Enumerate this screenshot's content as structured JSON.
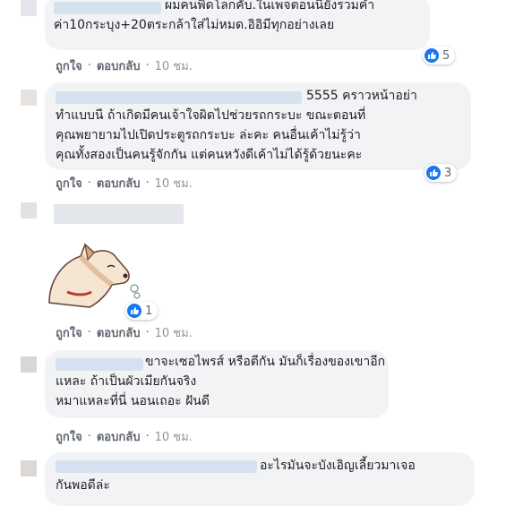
{
  "actions": {
    "like": "ถูกใจ",
    "reply": "ตอบกลับ",
    "separator": "·"
  },
  "comments": [
    {
      "lines": [
        "ผมคนพิดโลกคับ.ในเพจตอนนี้ยังรวมคำ",
        "ค่า10กระบุง+20ตระกล้าใส่ไม่หมด.อิอิมีทุกอย่างเลย"
      ],
      "reactions": "5",
      "time": "10 ชม."
    },
    {
      "lines": [
        "5555 คราวหน้าอย่า",
        "ทำแบบนี ถ้าเกิดมีคนเจ้าใจผิดไปช่วยรถกระบะ ขณะตอนที่",
        "คุณพยายามไปเปิดประตูรถกระบะ ล่ะคะ คนอื่นเค้าไม่รู้ว่า",
        "คุณทั้งสองเป็นคนรู้จักกัน แต่คนหวังดีเค้าไม่ได้รู้ด้วยนะคะ"
      ],
      "reactions": "3",
      "time": "10 ชม."
    },
    {
      "sticker": "dog-sticker",
      "reactions": "1",
      "time": "10 ชม."
    },
    {
      "lines": [
        "ขาจะเซอไพรส์ หรือตีกัน มันก็เรื่องของเขาอีก",
        "แหละ ถ้าเป็นผัวเมียกันจริง",
        "หมาแหละที่นี่ นอนเถอะ ฝันดี"
      ],
      "time": "10 ชม."
    },
    {
      "lines": [
        "อะไรมันจะบังเอิญเลี้ยวมาเจอ",
        "กันพอดีล่ะ"
      ]
    }
  ]
}
